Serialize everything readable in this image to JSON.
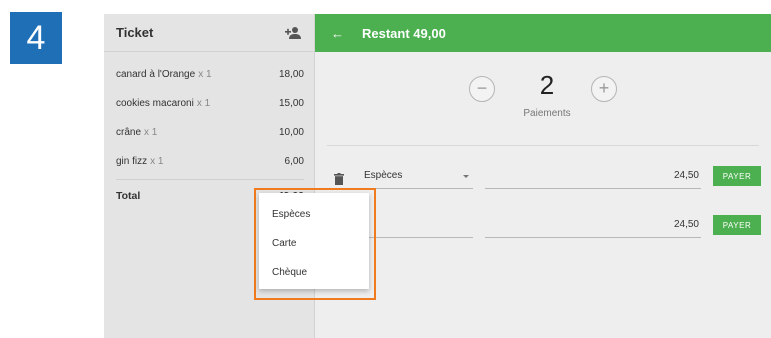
{
  "step_number": "4",
  "ticket": {
    "title": "Ticket",
    "lines": [
      {
        "name": "canard à l'Orange",
        "qty": "x 1",
        "price": "18,00"
      },
      {
        "name": "cookies macaroni",
        "qty": "x 1",
        "price": "15,00"
      },
      {
        "name": "crâne",
        "qty": "x 1",
        "price": "10,00"
      },
      {
        "name": "gin fizz",
        "qty": "x 1",
        "price": "6,00"
      }
    ],
    "total_label": "Total",
    "total_value": "49,00"
  },
  "payment": {
    "header_title": "Restant 49,00",
    "count_value": "2",
    "count_label": "Paiements",
    "minus_symbol": "−",
    "plus_symbol": "+",
    "rows": [
      {
        "method": "Espèces",
        "amount": "24,50",
        "pay_label": "PAYER"
      },
      {
        "method": "",
        "amount": "24,50",
        "pay_label": "PAYER"
      }
    ],
    "dropdown_options": [
      "Espèces",
      "Carte",
      "Chèque"
    ]
  },
  "colors": {
    "accent_green": "#4caf50",
    "badge_blue": "#1e6fb5",
    "highlight_orange": "#f07b1e"
  }
}
